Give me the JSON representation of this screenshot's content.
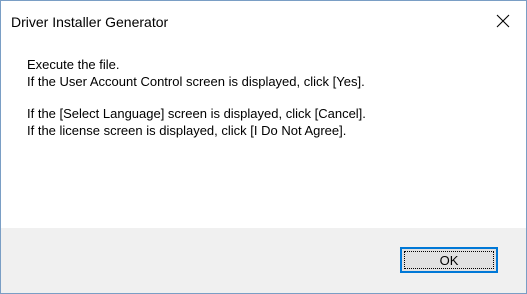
{
  "window": {
    "title": "Driver Installer Generator",
    "close_icon": "close-x-icon"
  },
  "message": {
    "lines": [
      "Execute the file.",
      "If the User Account Control screen is displayed, click [Yes].",
      "If the [Select Language] screen is displayed, click [Cancel].",
      "If the license screen is displayed, click [I Do Not Agree]."
    ]
  },
  "buttons": {
    "ok_label": "OK"
  },
  "colors": {
    "accent": "#0078d7",
    "footer_bg": "#f0f0f0",
    "button_bg": "#e1e1e1"
  }
}
